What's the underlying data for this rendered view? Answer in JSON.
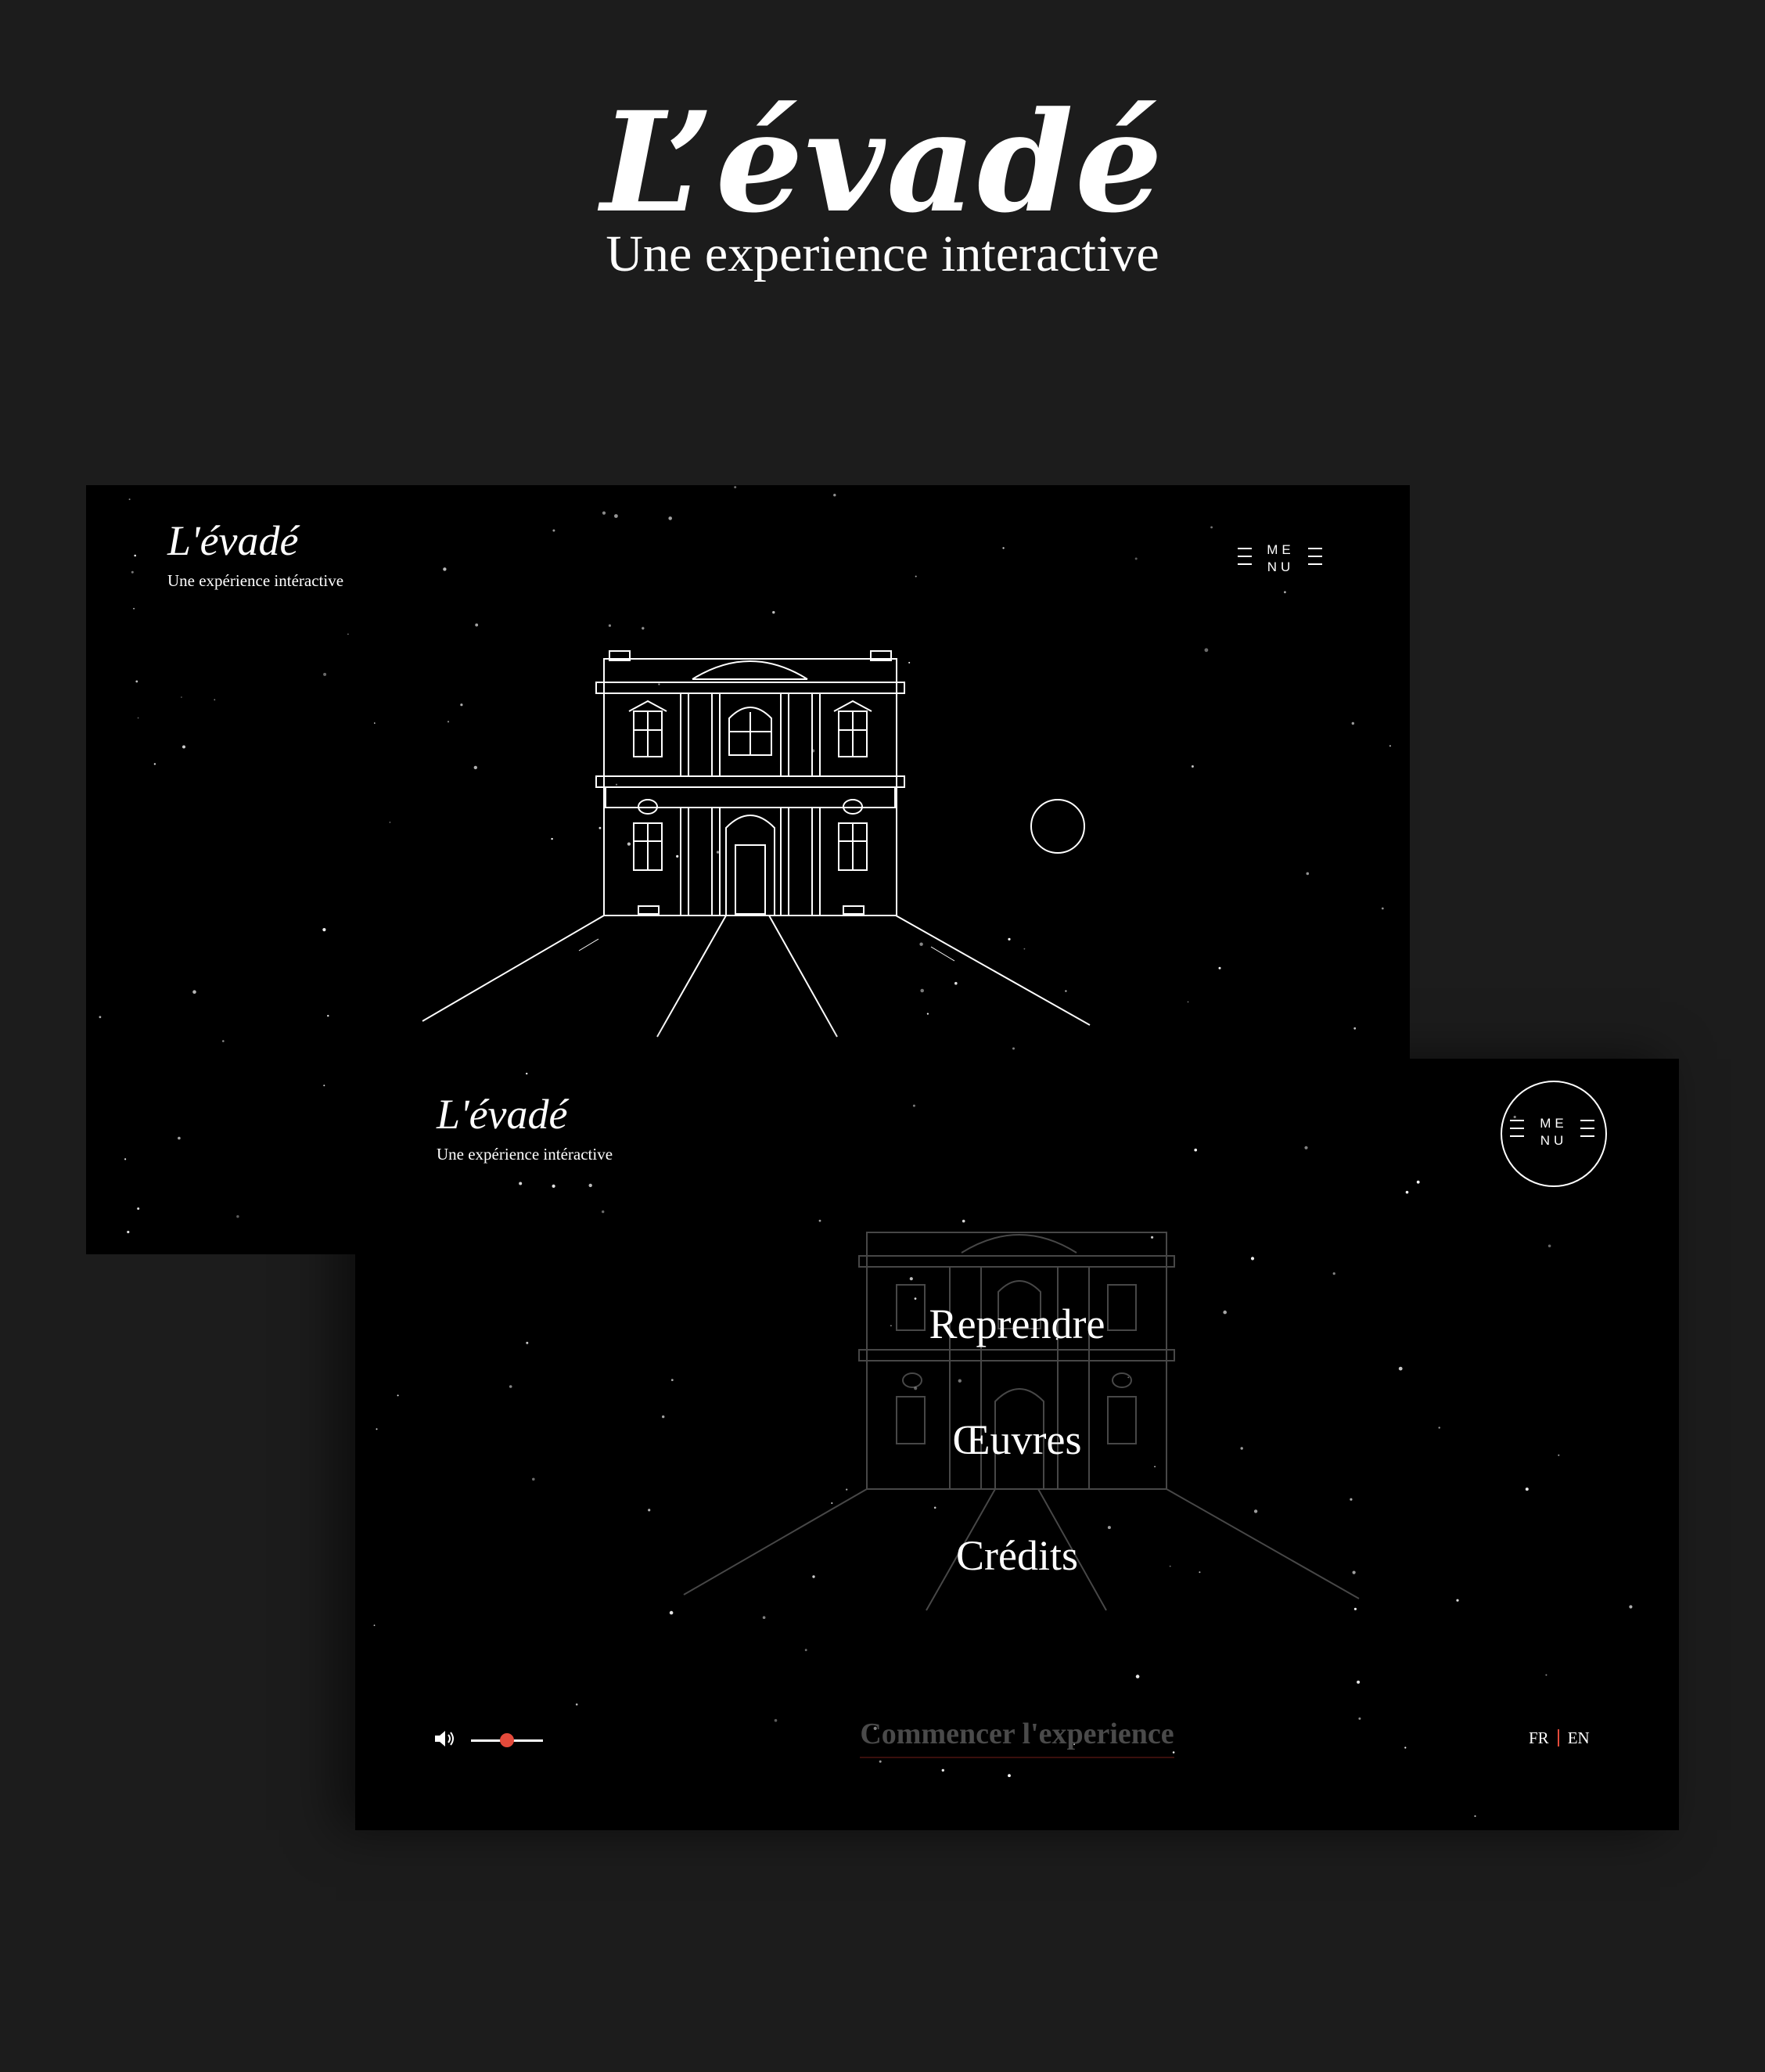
{
  "hero": {
    "title": "L’évadé",
    "subtitle": "Une experience interactive"
  },
  "screen1": {
    "logo_title": "L'évadé",
    "logo_subtitle": "Une expérience intéractive",
    "menu_top": "ME",
    "menu_bottom": "NU"
  },
  "screen2": {
    "logo_title": "L'évadé",
    "logo_subtitle": "Une expérience intéractive",
    "menu_top": "ME",
    "menu_bottom": "NU",
    "menu_items": [
      "Reprendre",
      "Œuvres",
      "Crédits"
    ],
    "start_label": "Commencer l'experience",
    "volume_level": 0.5,
    "languages": [
      "FR",
      "EN"
    ]
  },
  "colors": {
    "background": "#1c1c1c",
    "screen": "#000000",
    "accent": "#e44a3b",
    "muted_text": "#4a4a4a"
  },
  "icons": {
    "sound": "speaker-icon",
    "menu": "menu-icon",
    "moon": "moon-icon"
  }
}
